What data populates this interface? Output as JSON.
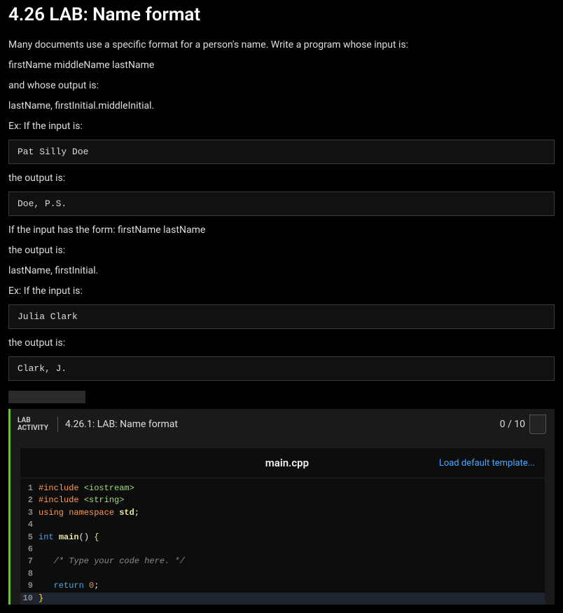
{
  "title": "4.26 LAB: Name format",
  "instructions": {
    "p1": "Many documents use a specific format for a person's name. Write a program whose input is:",
    "p2": "firstName middleName lastName",
    "p3": "and whose output is:",
    "p4": "lastName, firstInitial.middleInitial.",
    "p5": "Ex: If the input is:",
    "ex1": "Pat Silly Doe",
    "p6": "the output is:",
    "ex2": "Doe, P.S.",
    "p7": "If the input has the form: firstName lastName",
    "p8": "the output is:",
    "p9": "lastName, firstInitial.",
    "p10": "Ex: If the input is:",
    "ex3": "Julia Clark",
    "p11": "the output is:",
    "ex4": "Clark, J."
  },
  "activity": {
    "label_line1": "LAB",
    "label_line2": "ACTIVITY",
    "title": "4.26.1: LAB: Name format",
    "score": "0 / 10"
  },
  "editor": {
    "filename": "main.cpp",
    "load_template": "Load default template...",
    "lines": {
      "l1_a": "#include ",
      "l1_b": "<iostream>",
      "l2_a": "#include ",
      "l2_b": "<string>",
      "l3_a": "using ",
      "l3_b": "namespace ",
      "l3_c": "std",
      "l3_d": ";",
      "l4": "",
      "l5_a": "int ",
      "l5_b": "main",
      "l5_c": "() ",
      "l5_d": "{",
      "l6": "",
      "l7": "   /* Type your code here. */",
      "l8": "",
      "l9_a": "   ",
      "l9_b": "return ",
      "l9_c": "0",
      "l9_d": ";",
      "l10": "}"
    },
    "linenos": {
      "n1": "1",
      "n2": "2",
      "n3": "3",
      "n4": "4",
      "n5": "5",
      "n6": "6",
      "n7": "7",
      "n8": "8",
      "n9": "9",
      "n10": "10"
    }
  }
}
